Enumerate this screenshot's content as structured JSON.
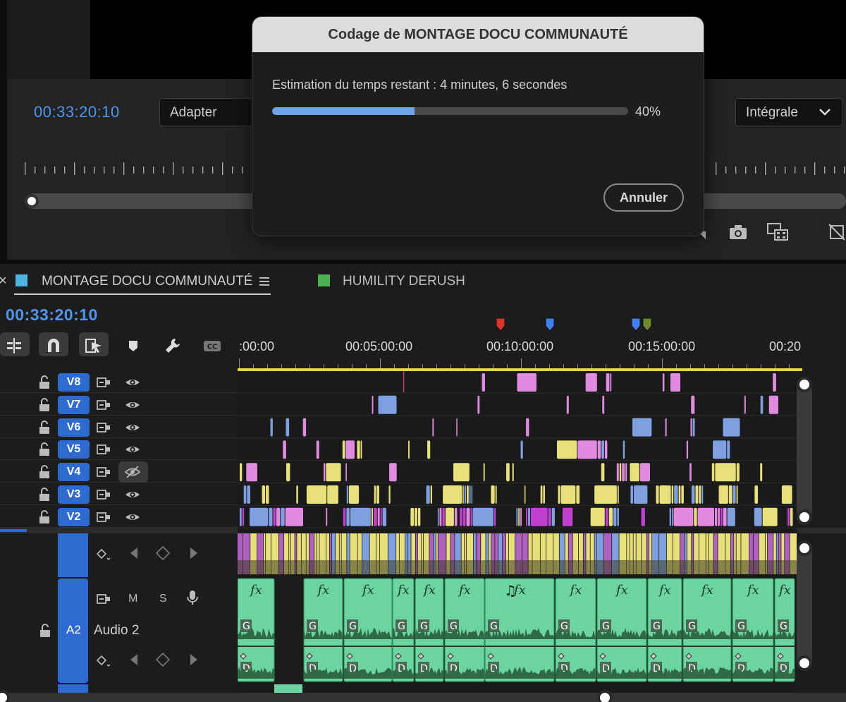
{
  "monitor": {
    "timecode": "00:33:20:10",
    "fit_value": "Adapter",
    "quality_value": "Intégrale"
  },
  "dialog": {
    "title": "Codage de MONTAGE DOCU COMMUNAUTÉ",
    "estimate": "Estimation du temps restant : 4 minutes, 6 secondes",
    "progress_percent": 40,
    "progress_label": "40%",
    "cancel_label": "Annuler"
  },
  "timeline": {
    "tabs": [
      {
        "label": "MONTAGE DOCU COMMUNAUTÉ",
        "color": "#4fb3e0",
        "active": true
      },
      {
        "label": "HUMILITY DERUSH",
        "color": "#4caf50",
        "active": false
      }
    ],
    "close_glyph": "×",
    "timecode": "00:33:20:10",
    "ruler_labels": [
      ":00:00",
      "00:05:00:00",
      "00:10:00:00",
      "00:15:00:00",
      "00:20"
    ],
    "tracks": [
      "V8",
      "V7",
      "V6",
      "V5",
      "V4",
      "V3",
      "V2"
    ],
    "audio_track": {
      "id": "A2",
      "name": "Audio 2",
      "mute": "M",
      "solo": "S"
    },
    "colors": {
      "timecode": "#4f96f0",
      "track_button": "#2d6bd1",
      "clip_yellow": "#e8e07a",
      "clip_pink": "#e08ae0",
      "clip_blue": "#7fa0e0",
      "audio_clip": "#6cd4a0"
    }
  }
}
